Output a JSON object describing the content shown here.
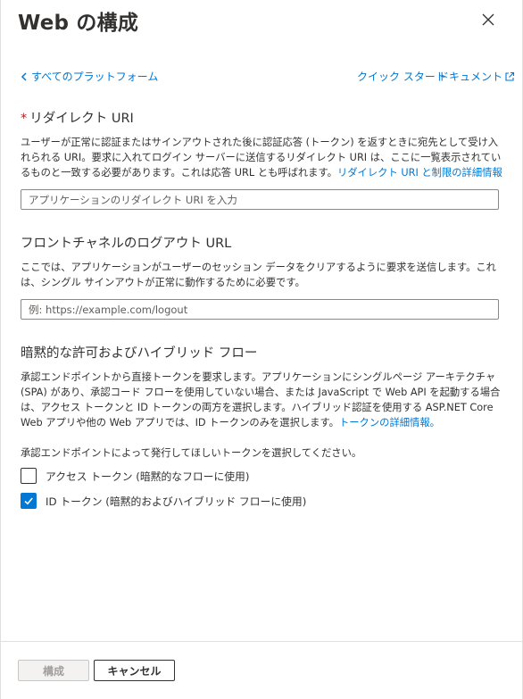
{
  "header": {
    "title": "Web の構成",
    "close_icon": "close-icon"
  },
  "nav": {
    "back_label": "すべてのプラットフォーム",
    "quickstart_label": "クイック スタート",
    "docs_label": "ドキュメント"
  },
  "redirect": {
    "required_mark": "*",
    "title": "リダイレクト URI",
    "desc": "ユーザーが正常に認証またはサインアウトされた後に認証応答 (トークン) を返すときに宛先として受け入れられる URI。要求に入れてログイン サーバーに送信するリダイレクト URI は、ここに一覧表示されているものと一致する必要があります。これは応答 URL とも呼ばれます。",
    "desc_link": "リダイレクト URI と制限の詳細情報",
    "input_value": "",
    "input_placeholder": "アプリケーションのリダイレクト URI を入力"
  },
  "logout": {
    "title": "フロントチャネルのログアウト URL",
    "desc": "ここでは、アプリケーションがユーザーのセッション データをクリアするように要求を送信します。これは、シングル サインアウトが正常に動作するために必要です。",
    "input_value": "",
    "input_placeholder": "例: https://example.com/logout"
  },
  "implicit": {
    "title": "暗黙的な許可およびハイブリッド フロー",
    "desc": "承認エンドポイントから直接トークンを要求します。アプリケーションにシングルページ アーキテクチャ (SPA) があり、承認コード フローを使用していない場合、または JavaScript で Web API を起動する場合は、アクセス トークンと ID トークンの両方を選択します。ハイブリッド認証を使用する ASP.NET Core Web アプリや他の Web アプリでは、ID トークンのみを選択します。",
    "desc_link": "トークンの詳細情報。",
    "select_prompt": "承認エンドポイントによって発行してほしいトークンを選択してください。",
    "checkboxes": [
      {
        "label": "アクセス トークン (暗黙的なフローに使用)",
        "checked": false
      },
      {
        "label": "ID トークン (暗黙的およびハイブリッド フローに使用)",
        "checked": true
      }
    ]
  },
  "footer": {
    "configure_label": "構成",
    "cancel_label": "キャンセル"
  },
  "colors": {
    "accent": "#0078d4",
    "required": "#a4262c",
    "text": "#323130"
  }
}
